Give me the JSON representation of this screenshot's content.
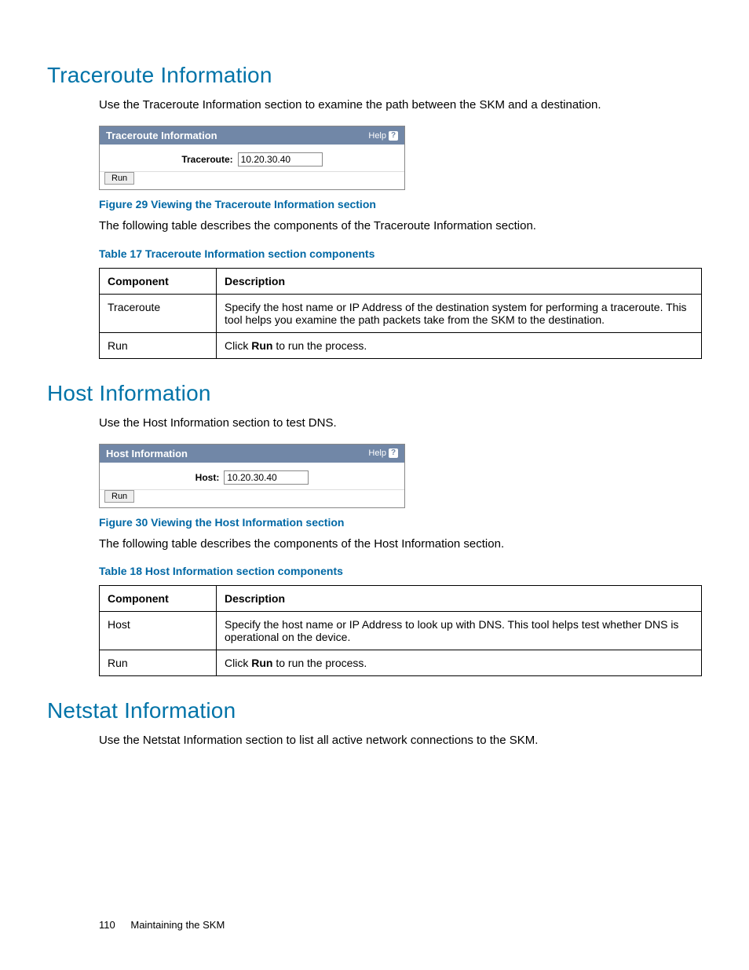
{
  "sections": {
    "traceroute": {
      "heading": "Traceroute Information",
      "intro": "Use the Traceroute Information section to examine the path between the SKM and a destination.",
      "panel": {
        "title": "Traceroute Information",
        "help": "Help",
        "field_label": "Traceroute:",
        "field_value": "10.20.30.40",
        "run_button": "Run"
      },
      "figure_caption": "Figure 29 Viewing the Traceroute Information section",
      "table_intro": "The following table describes the components of the Traceroute Information section.",
      "table_caption": "Table 17 Traceroute Information section components",
      "table_headers": {
        "col1": "Component",
        "col2": "Description"
      },
      "rows": [
        {
          "component": "Traceroute",
          "description": "Specify the host name or IP Address of the destination system for performing a traceroute. This tool helps you examine the path packets take from the SKM to the destination."
        },
        {
          "component": "Run",
          "description_pre": "Click ",
          "description_bold": "Run",
          "description_post": " to run the process."
        }
      ]
    },
    "host": {
      "heading": "Host Information",
      "intro": "Use the Host Information section to test DNS.",
      "panel": {
        "title": "Host Information",
        "help": "Help",
        "field_label": "Host:",
        "field_value": "10.20.30.40",
        "run_button": "Run"
      },
      "figure_caption": "Figure 30 Viewing the Host Information section",
      "table_intro": "The following table describes the components of the Host Information section.",
      "table_caption": "Table 18 Host Information section components",
      "table_headers": {
        "col1": "Component",
        "col2": "Description"
      },
      "rows": [
        {
          "component": "Host",
          "description": "Specify the host name or IP Address to look up with DNS. This tool helps test whether DNS is operational on the device."
        },
        {
          "component": "Run",
          "description_pre": "Click ",
          "description_bold": "Run",
          "description_post": " to run the process."
        }
      ]
    },
    "netstat": {
      "heading": "Netstat Information",
      "intro": "Use the Netstat Information section to list all active network connections to the SKM."
    }
  },
  "footer": {
    "page_number": "110",
    "title": "Maintaining the SKM"
  }
}
